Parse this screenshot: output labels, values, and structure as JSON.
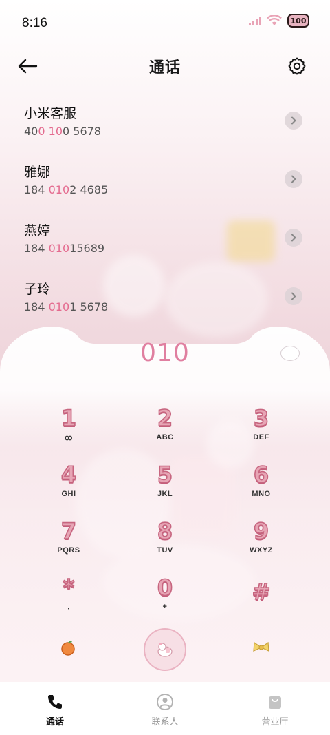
{
  "status_bar": {
    "time": "8:16",
    "battery": "100",
    "signal_icon": "signal-icon",
    "wifi_icon": "wifi-icon"
  },
  "header": {
    "title": "通话",
    "back_icon": "back-arrow-icon",
    "settings_icon": "gear-icon"
  },
  "call_list": [
    {
      "name": "小米客服",
      "number_parts": [
        {
          "t": "40",
          "hl": false
        },
        {
          "t": "0",
          "hl": true
        },
        {
          "t": " ",
          "hl": false
        },
        {
          "t": "10",
          "hl": true
        },
        {
          "t": "0 5678",
          "hl": false
        }
      ]
    },
    {
      "name": "雅娜",
      "number_parts": [
        {
          "t": "184 ",
          "hl": false
        },
        {
          "t": "010",
          "hl": true
        },
        {
          "t": "2 4685",
          "hl": false
        }
      ]
    },
    {
      "name": "燕婷",
      "number_parts": [
        {
          "t": "184 ",
          "hl": false
        },
        {
          "t": "010",
          "hl": true
        },
        {
          "t": "15689",
          "hl": false
        }
      ]
    },
    {
      "name": "子玲",
      "number_parts": [
        {
          "t": "184 ",
          "hl": false
        },
        {
          "t": "010",
          "hl": true
        },
        {
          "t": "1 5678",
          "hl": false
        }
      ]
    }
  ],
  "dialpad": {
    "display": "010",
    "keys": [
      {
        "digit": "1",
        "letters": "ꝏ"
      },
      {
        "digit": "2",
        "letters": "ABC"
      },
      {
        "digit": "3",
        "letters": "DEF"
      },
      {
        "digit": "4",
        "letters": "GHI"
      },
      {
        "digit": "5",
        "letters": "JKL"
      },
      {
        "digit": "6",
        "letters": "MNO"
      },
      {
        "digit": "7",
        "letters": "PQRS"
      },
      {
        "digit": "8",
        "letters": "TUV"
      },
      {
        "digit": "9",
        "letters": "WXYZ"
      },
      {
        "digit": "*",
        "letters": ","
      },
      {
        "digit": "0",
        "letters": "+"
      },
      {
        "digit": "#",
        "letters": ""
      }
    ]
  },
  "bottom_nav": {
    "items": [
      {
        "label": "通话",
        "icon": "phone-icon",
        "active": true
      },
      {
        "label": "联系人",
        "icon": "contact-icon",
        "active": false
      },
      {
        "label": "营业厅",
        "icon": "shopping-bag-icon",
        "active": false
      }
    ]
  },
  "colors": {
    "accent": "#e07fa0",
    "highlight": "#e46b8f",
    "key_digit": "#e7a5b5"
  }
}
